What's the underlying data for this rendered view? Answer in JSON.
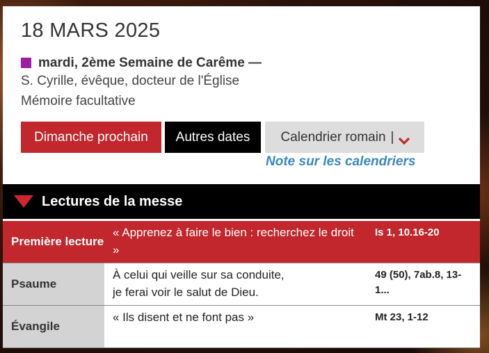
{
  "date": "18 MARS 2025",
  "liturgy": {
    "season_line": "mardi, 2ème Semaine de Carême —",
    "color": "#9b1fa0",
    "saint": "S. Cyrille, évêque, docteur de l'Église",
    "rank": "Mémoire facultative"
  },
  "buttons": {
    "next_sunday": "Dimanche prochain",
    "other_dates": "Autres dates",
    "calendar": "Calendrier romain",
    "calendar_sep": "|"
  },
  "note_link": "Note sur les calendriers",
  "readings": {
    "title": "Lectures de la messe",
    "rows": [
      {
        "label": "Première lecture",
        "text": "« Apprenez à faire le bien : recherchez le droit »",
        "ref": "Is 1, 10.16-20"
      },
      {
        "label": "Psaume",
        "text_line1": "À celui qui veille sur sa conduite,",
        "text_line2": "je ferai voir le salut de Dieu.",
        "ref": "49 (50), 7ab.8, 13-1..."
      },
      {
        "label": "Évangile",
        "text": "« Ils disent et ne font pas »",
        "ref": "Mt 23, 1-12"
      }
    ]
  },
  "colors": {
    "accent_red": "#c1272d",
    "link_blue": "#3a87bb",
    "header_black": "#000000"
  },
  "icons": [
    "chevron-down-icon",
    "triangle-down-icon"
  ]
}
